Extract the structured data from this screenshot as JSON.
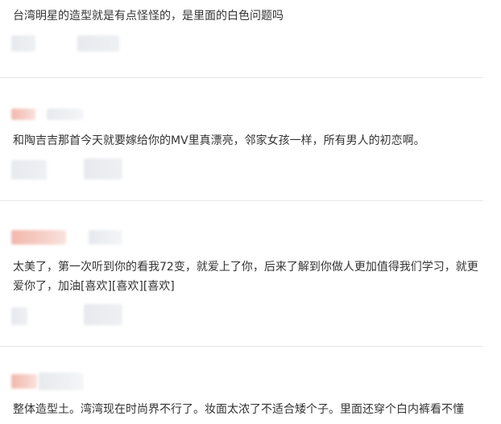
{
  "comments": [
    {
      "text": "台湾明星的造型就是有点怪怪的，是里面的白色问题吗"
    },
    {
      "text": "和陶吉吉那首今天就要嫁给你的MV里真漂亮，邻家女孩一样，所有男人的初恋啊。"
    },
    {
      "text": "太美了，第一次听到你的看我72变，就爱上了你，后来了解到你做人更加值得我们学习，就更爱你了，加油[喜欢][喜欢][喜欢]"
    },
    {
      "text": "整体造型土。湾湾现在时尚界不行了。妆面太浓了不适合矮个子。里面还穿个白内裤看不懂"
    }
  ]
}
